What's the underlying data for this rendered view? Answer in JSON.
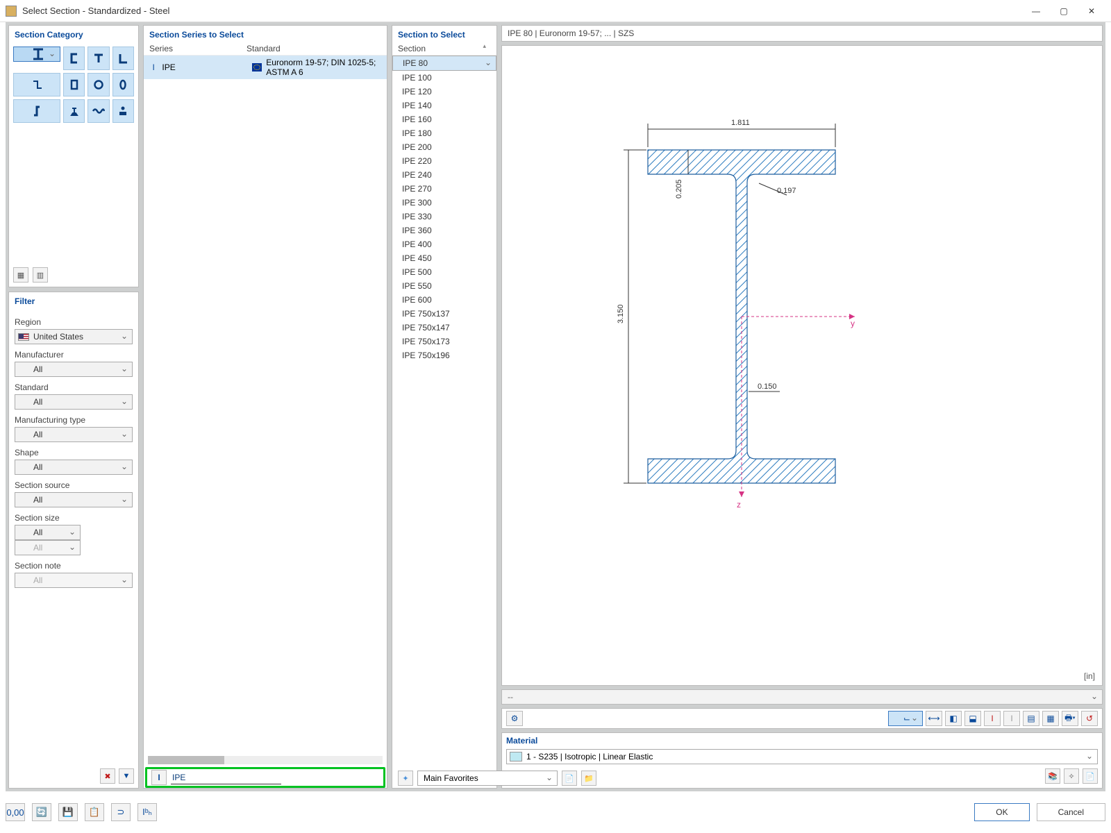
{
  "window": {
    "title": "Select Section - Standardized - Steel"
  },
  "left": {
    "category_header": "Section Category",
    "filter_header": "Filter",
    "filters": {
      "region_label": "Region",
      "region_value": "United States",
      "manufacturer_label": "Manufacturer",
      "manufacturer_value": "All",
      "standard_label": "Standard",
      "standard_value": "All",
      "mtype_label": "Manufacturing type",
      "mtype_value": "All",
      "shape_label": "Shape",
      "shape_value": "All",
      "source_label": "Section source",
      "source_value": "All",
      "size_label": "Section size",
      "size_value1": "All",
      "size_value2": "All",
      "note_label": "Section note",
      "note_value": "All"
    }
  },
  "series": {
    "header": "Section Series to Select",
    "col1": "Series",
    "col2": "Standard",
    "row_series": "IPE",
    "row_standard": "Euronorm 19-57; DIN 1025-5; ASTM A 6",
    "search_value": "IPE"
  },
  "sections": {
    "header": "Section to Select",
    "col": "Section",
    "items": [
      "IPE 80",
      "IPE 100",
      "IPE 120",
      "IPE 140",
      "IPE 160",
      "IPE 180",
      "IPE 200",
      "IPE 220",
      "IPE 240",
      "IPE 270",
      "IPE 300",
      "IPE 330",
      "IPE 360",
      "IPE 400",
      "IPE 450",
      "IPE 500",
      "IPE 550",
      "IPE 600",
      "IPE 750x137",
      "IPE 750x147",
      "IPE 750x173",
      "IPE 750x196"
    ]
  },
  "favorites": {
    "label": "Main Favorites"
  },
  "preview": {
    "title": "IPE 80 | Euronorm 19-57; ... | SZS",
    "unit": "[in]",
    "blank": "--",
    "dims": {
      "width": "1.811",
      "height": "3.150",
      "tf": "0.205",
      "r": "0.197",
      "tw": "0.150",
      "y": "y",
      "z": "z"
    }
  },
  "material": {
    "header": "Material",
    "value": "1 - S235 | Isotropic | Linear Elastic"
  },
  "buttons": {
    "ok": "OK",
    "cancel": "Cancel"
  }
}
